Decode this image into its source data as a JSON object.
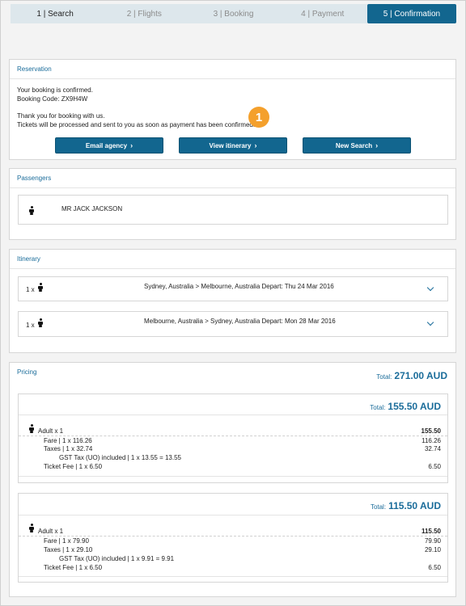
{
  "steps": [
    {
      "label": "1 | Search"
    },
    {
      "label": "2 | Flights"
    },
    {
      "label": "3 | Booking"
    },
    {
      "label": "4 | Payment"
    },
    {
      "label": "5 | Confirmation"
    }
  ],
  "reservation": {
    "title": "Reservation",
    "confirmed": "Your booking is confirmed.",
    "booking_code": "Booking Code: ZX9H4W",
    "thanks": "Thank you for booking with us.",
    "tickets_note": "Tickets will be processed and sent to you as soon as payment has been confirmed.",
    "buttons": {
      "email": "Email agency",
      "view": "View itinerary",
      "new": "New Search"
    },
    "badge": "1"
  },
  "passengers": {
    "title": "Passengers",
    "list": [
      {
        "name": "MR JACK JACKSON"
      }
    ]
  },
  "itinerary": {
    "title": "Itinerary",
    "legs": [
      {
        "count": "1 x",
        "route": "Sydney, Australia > Melbourne, Australia Depart: Thu 24 Mar 2016"
      },
      {
        "count": "1 x",
        "route": "Melbourne, Australia > Sydney, Australia Depart: Mon 28 Mar 2016"
      }
    ]
  },
  "pricing": {
    "title": "Pricing",
    "total_label": "Total:",
    "total_value": "271.00 AUD",
    "legs": [
      {
        "total_label": "Total:",
        "total_value": "155.50 AUD",
        "passenger": "Adult x 1",
        "passenger_amount": "155.50",
        "fare": "Fare | 1 x 116.26",
        "fare_amount": "116.26",
        "taxes": "Taxes | 1 x 32.74",
        "taxes_amount": "32.74",
        "gst": "GST Tax (UO) included | 1 x 13.55 = 13.55",
        "ticket_fee": "Ticket Fee | 1 x 6.50",
        "ticket_fee_amount": "6.50"
      },
      {
        "total_label": "Total:",
        "total_value": "115.50 AUD",
        "passenger": "Adult x 1",
        "passenger_amount": "115.50",
        "fare": "Fare | 1 x 79.90",
        "fare_amount": "79.90",
        "taxes": "Taxes | 1 x 29.10",
        "taxes_amount": "29.10",
        "gst": "GST Tax (UO) included | 1 x 9.91 = 9.91",
        "ticket_fee": "Ticket Fee | 1 x 6.50",
        "ticket_fee_amount": "6.50"
      }
    ]
  },
  "icons": {
    "button_chevron": "chevron-right-icon",
    "expand": "chevron-down-icon",
    "person": "person-icon"
  },
  "colors": {
    "primary": "#12668f",
    "link": "#1a6c9a",
    "step_inactive": "#dde7ec",
    "badge": "#f4a02c"
  }
}
